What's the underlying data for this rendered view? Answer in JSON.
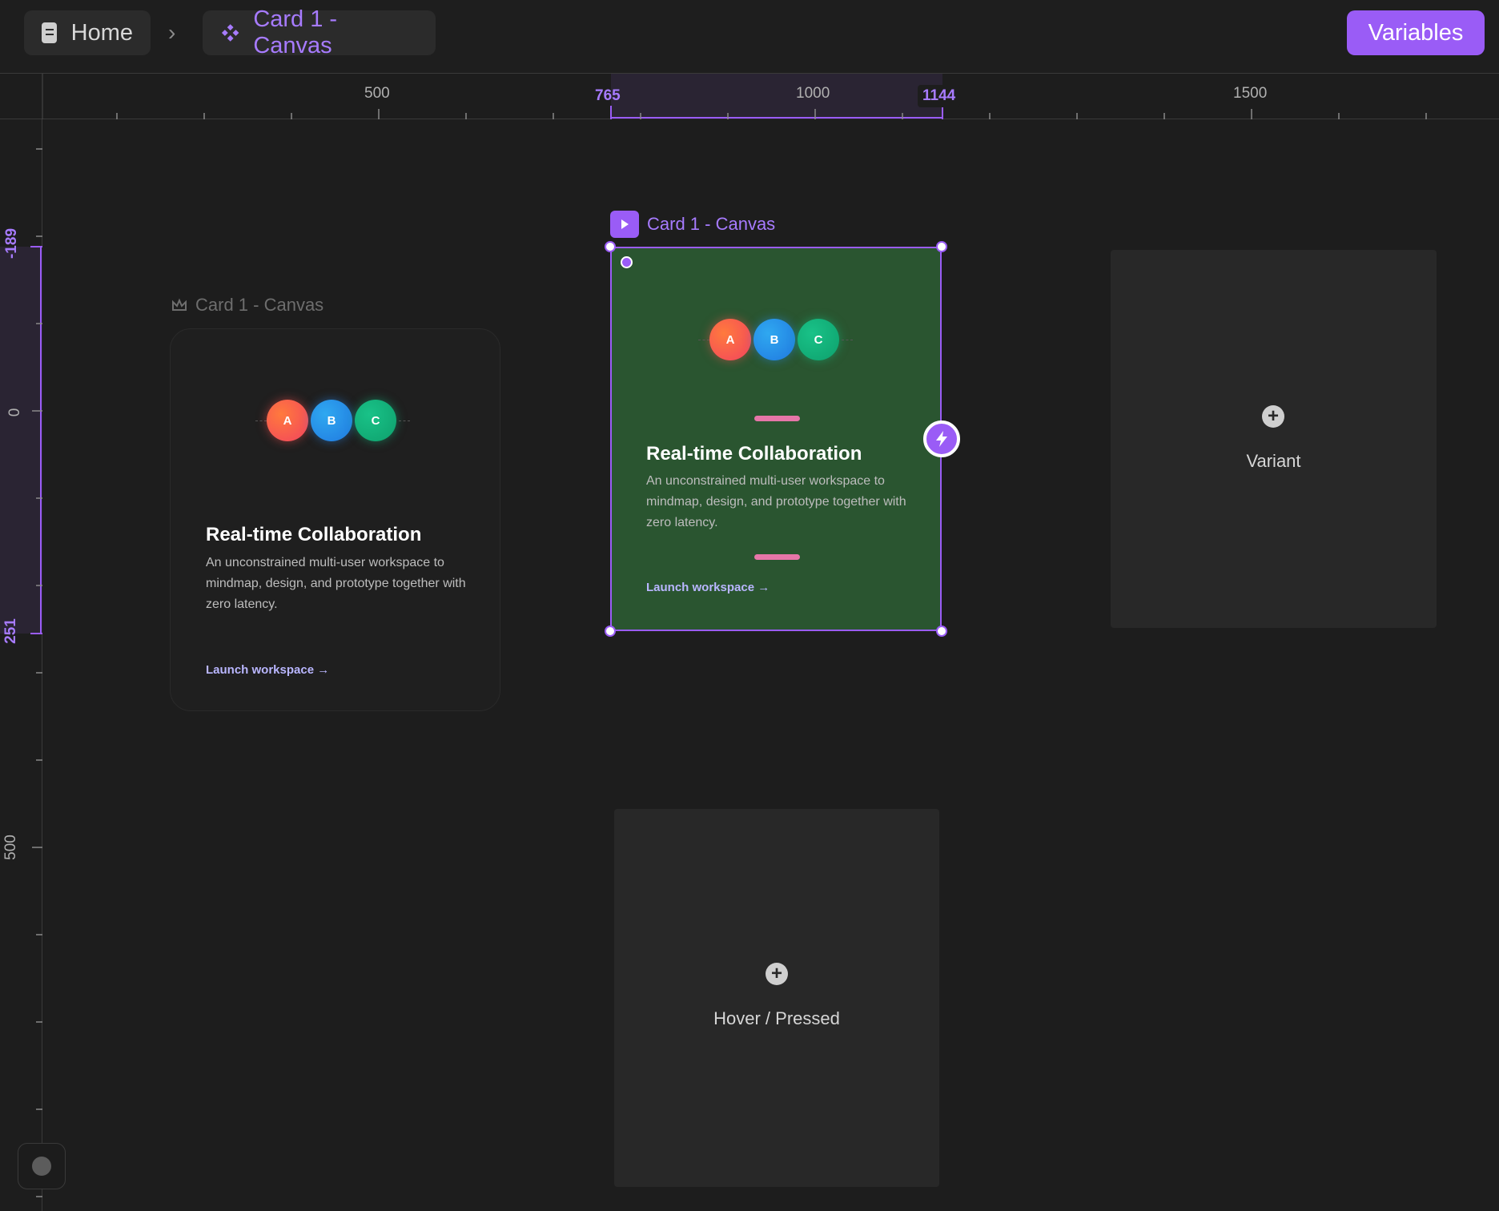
{
  "breadcrumb": {
    "home_label": "Home",
    "component_label": "Card 1 - Canvas"
  },
  "toolbar": {
    "variables_label": "Variables"
  },
  "ruler_top": {
    "labels": [
      "500",
      "1000",
      "1500"
    ],
    "selection_start": "765",
    "selection_end": "1144"
  },
  "ruler_left": {
    "labels": [
      "0",
      "500"
    ],
    "selection_start": "-189",
    "selection_end": "251"
  },
  "canvas": {
    "main_component": {
      "frame_label": "Card 1 - Canvas",
      "circles": [
        "A",
        "B",
        "C"
      ],
      "title": "Real-time Collaboration",
      "description": "An unconstrained multi-user workspace to mindmap, design, and prototype together with zero latency.",
      "link": "Launch workspace →"
    },
    "selected_variant": {
      "frame_label": "Card 1 - Canvas",
      "circles": [
        "A",
        "B",
        "C"
      ],
      "title": "Real-time Collaboration",
      "description": "An unconstrained multi-user workspace to mindmap, design, and prototype together with zero latency.",
      "link": "Launch workspace →",
      "background": "#2a5530"
    },
    "variant_placeholder": {
      "label": "Variant"
    },
    "hover_placeholder": {
      "label": "Hover / Pressed"
    }
  },
  "colors": {
    "accent": "#9a5cf6",
    "background": "#1d1d1d",
    "pink": "#e676a8",
    "link": "#b9b6ff"
  },
  "icons": {
    "home": "document-icon",
    "component": "component-icon",
    "frame": "crown-icon",
    "selected_frame": "play-icon",
    "interaction": "bolt-icon",
    "add": "plus-icon"
  }
}
